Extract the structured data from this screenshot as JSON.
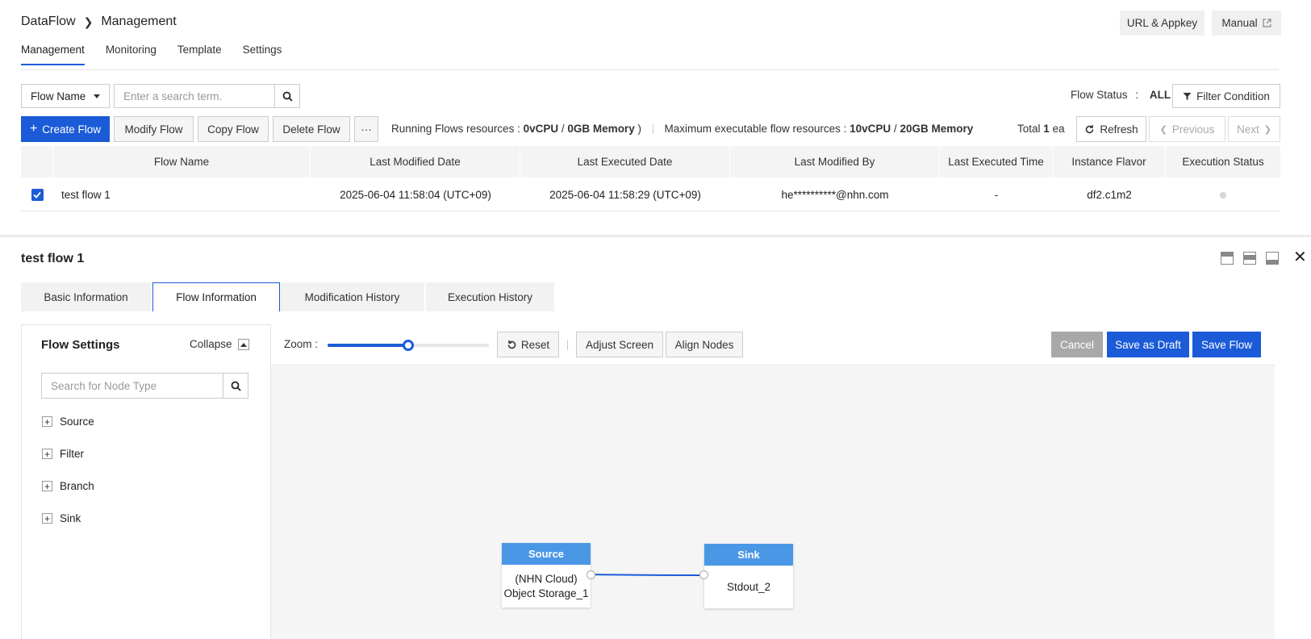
{
  "header": {
    "breadcrumb_root": "DataFlow",
    "breadcrumb_current": "Management",
    "url_appkey_label": "URL & Appkey",
    "manual_label": "Manual"
  },
  "main_tabs": [
    {
      "label": "Management",
      "active": true
    },
    {
      "label": "Monitoring",
      "active": false
    },
    {
      "label": "Template",
      "active": false
    },
    {
      "label": "Settings",
      "active": false
    }
  ],
  "search": {
    "field_select": "Flow Name",
    "placeholder": "Enter a search term.",
    "flow_status_label": "Flow Status",
    "flow_status_colon": ":",
    "flow_status_value": "ALL",
    "filter_label": "Filter Condition"
  },
  "actions": {
    "create": "Create Flow",
    "create_prefix": "+",
    "modify": "Modify Flow",
    "copy": "Copy Flow",
    "delete": "Delete Flow",
    "more": "···",
    "running_label": "Running Flows resources :",
    "running_cpu": "0vCPU",
    "running_slash": "/",
    "running_mem": "0GB Memory",
    "running_close": ")",
    "max_label": "Maximum executable flow resources :",
    "max_cpu": "10vCPU",
    "max_slash": "/",
    "max_mem": "20GB Memory",
    "total_prefix": "Total",
    "total_count": "1",
    "total_suffix": "ea",
    "refresh": "Refresh",
    "previous": "Previous",
    "next": "Next"
  },
  "table": {
    "columns": [
      "Flow Name",
      "Last Modified Date",
      "Last Executed Date",
      "Last Modified By",
      "Last Executed Time",
      "Instance Flavor",
      "Execution Status"
    ],
    "rows": [
      {
        "checked": true,
        "flow_name": "test flow 1",
        "last_modified_date": "2025-06-04 11:58:04 (UTC+09)",
        "last_executed_date": "2025-06-04 11:58:29 (UTC+09)",
        "last_modified_by": "he**********@nhn.com",
        "last_executed_time": "-",
        "instance_flavor": "df2.c1m2"
      }
    ]
  },
  "detail": {
    "title": "test flow 1",
    "tabs": [
      {
        "label": "Basic Information",
        "active": false
      },
      {
        "label": "Flow Information",
        "active": true
      },
      {
        "label": "Modification History",
        "active": false
      },
      {
        "label": "Execution History",
        "active": false
      }
    ],
    "sidebar": {
      "title": "Flow Settings",
      "collapse_label": "Collapse",
      "search_placeholder": "Search for Node Type",
      "tree": [
        "Source",
        "Filter",
        "Branch",
        "Sink"
      ]
    },
    "toolbar": {
      "zoom_label": "Zoom :",
      "zoom_level": 0.5,
      "reset": "Reset",
      "adjust": "Adjust Screen",
      "align": "Align Nodes",
      "cancel": "Cancel",
      "save_draft": "Save as Draft",
      "save_flow": "Save Flow"
    },
    "nodes": [
      {
        "header": "Source",
        "line1": "(NHN Cloud)",
        "line2": "Object Storage_1"
      },
      {
        "header": "Sink",
        "body": "Stdout_2"
      }
    ]
  },
  "colors": {
    "accent": "#1b5bd7",
    "node_header": "#4a97e6",
    "cancel": "#a8a8a8",
    "canvas": "#f5f5f5"
  }
}
